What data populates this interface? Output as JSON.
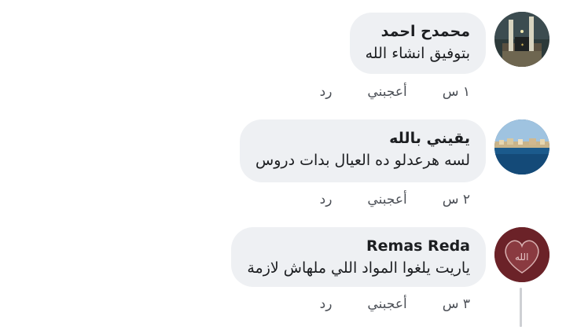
{
  "comments": [
    {
      "name": "محمدح احمد",
      "text": "بتوفيق انشاء الله",
      "time": "١ س",
      "like_label": "أعجبني",
      "reply_label": "رد",
      "avatar_icon": "mosque-avatar"
    },
    {
      "name": "يقيني بالله",
      "text": "لسه هرعدلو ده العيال بدات دروس",
      "time": "٢ س",
      "like_label": "أعجبني",
      "reply_label": "رد",
      "avatar_icon": "seaside-avatar"
    },
    {
      "name": "Remas Reda",
      "text": "ياريت يلغوا المواد اللي ملهاش لازمة",
      "time": "٣ س",
      "like_label": "أعجبني",
      "reply_label": "رد",
      "avatar_icon": "heart-calligraphy-avatar"
    }
  ],
  "colors": {
    "bubble": "#eef0f3",
    "text": "#1c1e21",
    "meta": "#4b4f56"
  }
}
